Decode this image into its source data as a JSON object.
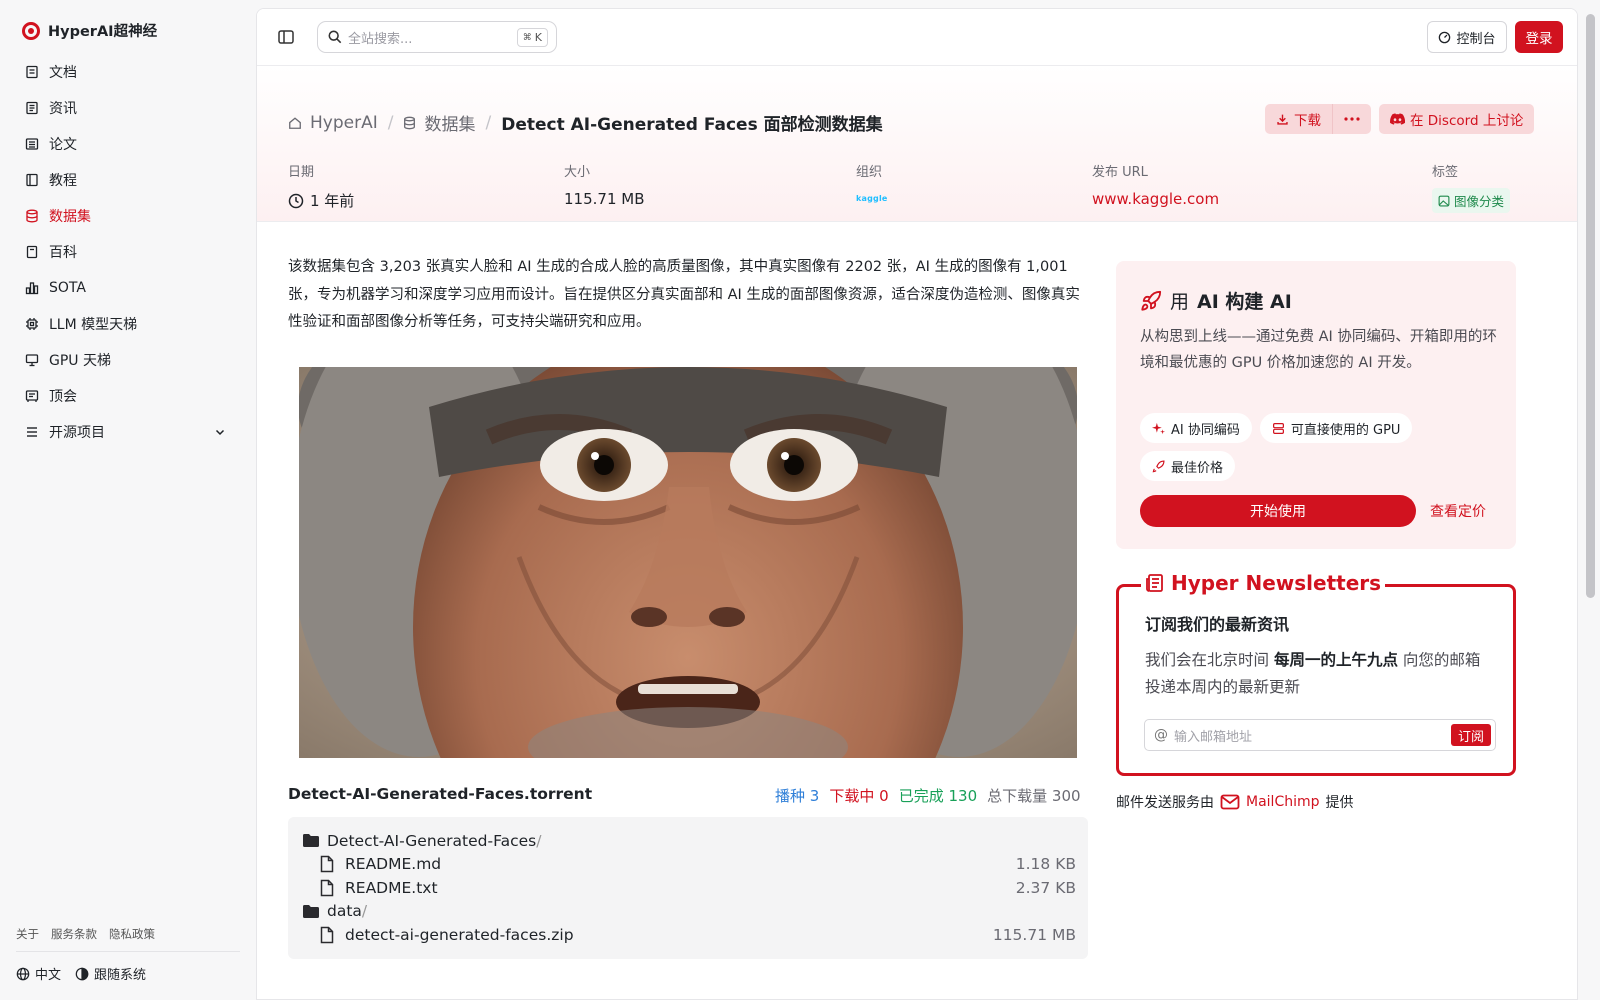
{
  "brand": {
    "name": "HyperAI超神经"
  },
  "nav": [
    {
      "label": "文档",
      "icon": "document-icon"
    },
    {
      "label": "资讯",
      "icon": "news-icon"
    },
    {
      "label": "论文",
      "icon": "paper-icon"
    },
    {
      "label": "教程",
      "icon": "tutorial-icon"
    },
    {
      "label": "数据集",
      "icon": "database-icon"
    },
    {
      "label": "百科",
      "icon": "wiki-icon"
    },
    {
      "label": "SOTA",
      "icon": "bar-chart-icon"
    },
    {
      "label": "LLM 模型天梯",
      "icon": "cpu-icon"
    },
    {
      "label": "GPU 天梯",
      "icon": "monitor-icon"
    },
    {
      "label": "顶会",
      "icon": "conference-icon"
    },
    {
      "label": "开源项目",
      "icon": "list-icon"
    }
  ],
  "sidebar_footer": {
    "about": "关于",
    "terms": "服务条款",
    "privacy": "隐私政策",
    "language": "中文",
    "theme": "跟随系统"
  },
  "topbar": {
    "search_placeholder": "全站搜索...",
    "search_shortcut": "K",
    "console": "控制台",
    "login": "登录"
  },
  "breadcrumb": {
    "home": "HyperAI",
    "section": "数据集",
    "current": "Detect AI-Generated Faces 面部检测数据集"
  },
  "actions": {
    "download": "下载",
    "discord": "在 Discord 上讨论"
  },
  "meta": {
    "date_label": "日期",
    "date_value": "1 年前",
    "size_label": "大小",
    "size_value": "115.71 MB",
    "org_label": "组织",
    "org_logo_text": "kaggle",
    "url_label": "发布 URL",
    "url_value": "www.kaggle.com",
    "tag_label": "标签",
    "tag_value": "图像分类"
  },
  "description": "该数据集包含 3,203 张真实人脸和 AI 生成的合成人脸的高质量图像，其中真实图像有 2202 张，AI 生成的图像有 1,001 张，专为机器学习和深度学习应用而设计。旨在提供区分真实面部和 AI 生成的面部图像资源，适合深度伪造检测、图像真实性验证和面部图像分析等任务，可支持尖端研究和应用。",
  "torrent": {
    "name": "Detect-AI-Generated-Faces.torrent",
    "seed_label": "播种",
    "seed": "3",
    "downloading_label": "下载中",
    "downloading": "0",
    "completed_label": "已完成",
    "completed": "130",
    "total_label": "总下载量",
    "total": "300"
  },
  "files": [
    {
      "name": "Detect-AI-Generated-Faces",
      "type": "folder",
      "size": ""
    },
    {
      "name": "README.md",
      "type": "file",
      "size": "1.18 KB"
    },
    {
      "name": "README.txt",
      "type": "file",
      "size": "2.37 KB"
    },
    {
      "name": "data",
      "type": "folder",
      "size": ""
    },
    {
      "name": "detect-ai-generated-faces.zip",
      "type": "file",
      "size": "115.71 MB"
    }
  ],
  "promo": {
    "title_prefix": "用 ",
    "title_bold": "AI 构建 AI",
    "desc": "从构思到上线——通过免费 AI 协同编码、开箱即用的环境和最优惠的 GPU 价格加速您的 AI 开发。",
    "chips": [
      "AI 协同编码",
      "可直接使用的 GPU",
      "最佳价格"
    ],
    "start": "开始使用",
    "pricing": "查看定价"
  },
  "newsletter": {
    "title": "Hyper Newsletters",
    "heading": "订阅我们的最新资讯",
    "text_1": "我们会在北京时间 ",
    "text_bold": "每周一的上午九点",
    "text_2": " 向您的邮箱投递本周内的最新更新",
    "placeholder": "输入邮箱地址",
    "submit": "订阅"
  },
  "mail_credit": {
    "prefix": "邮件发送服务由",
    "provider": "MailChimp",
    "suffix": "提供"
  },
  "colors": {
    "accent": "#d1121f",
    "seed": "#2f7fd8",
    "completed": "#18a058"
  }
}
